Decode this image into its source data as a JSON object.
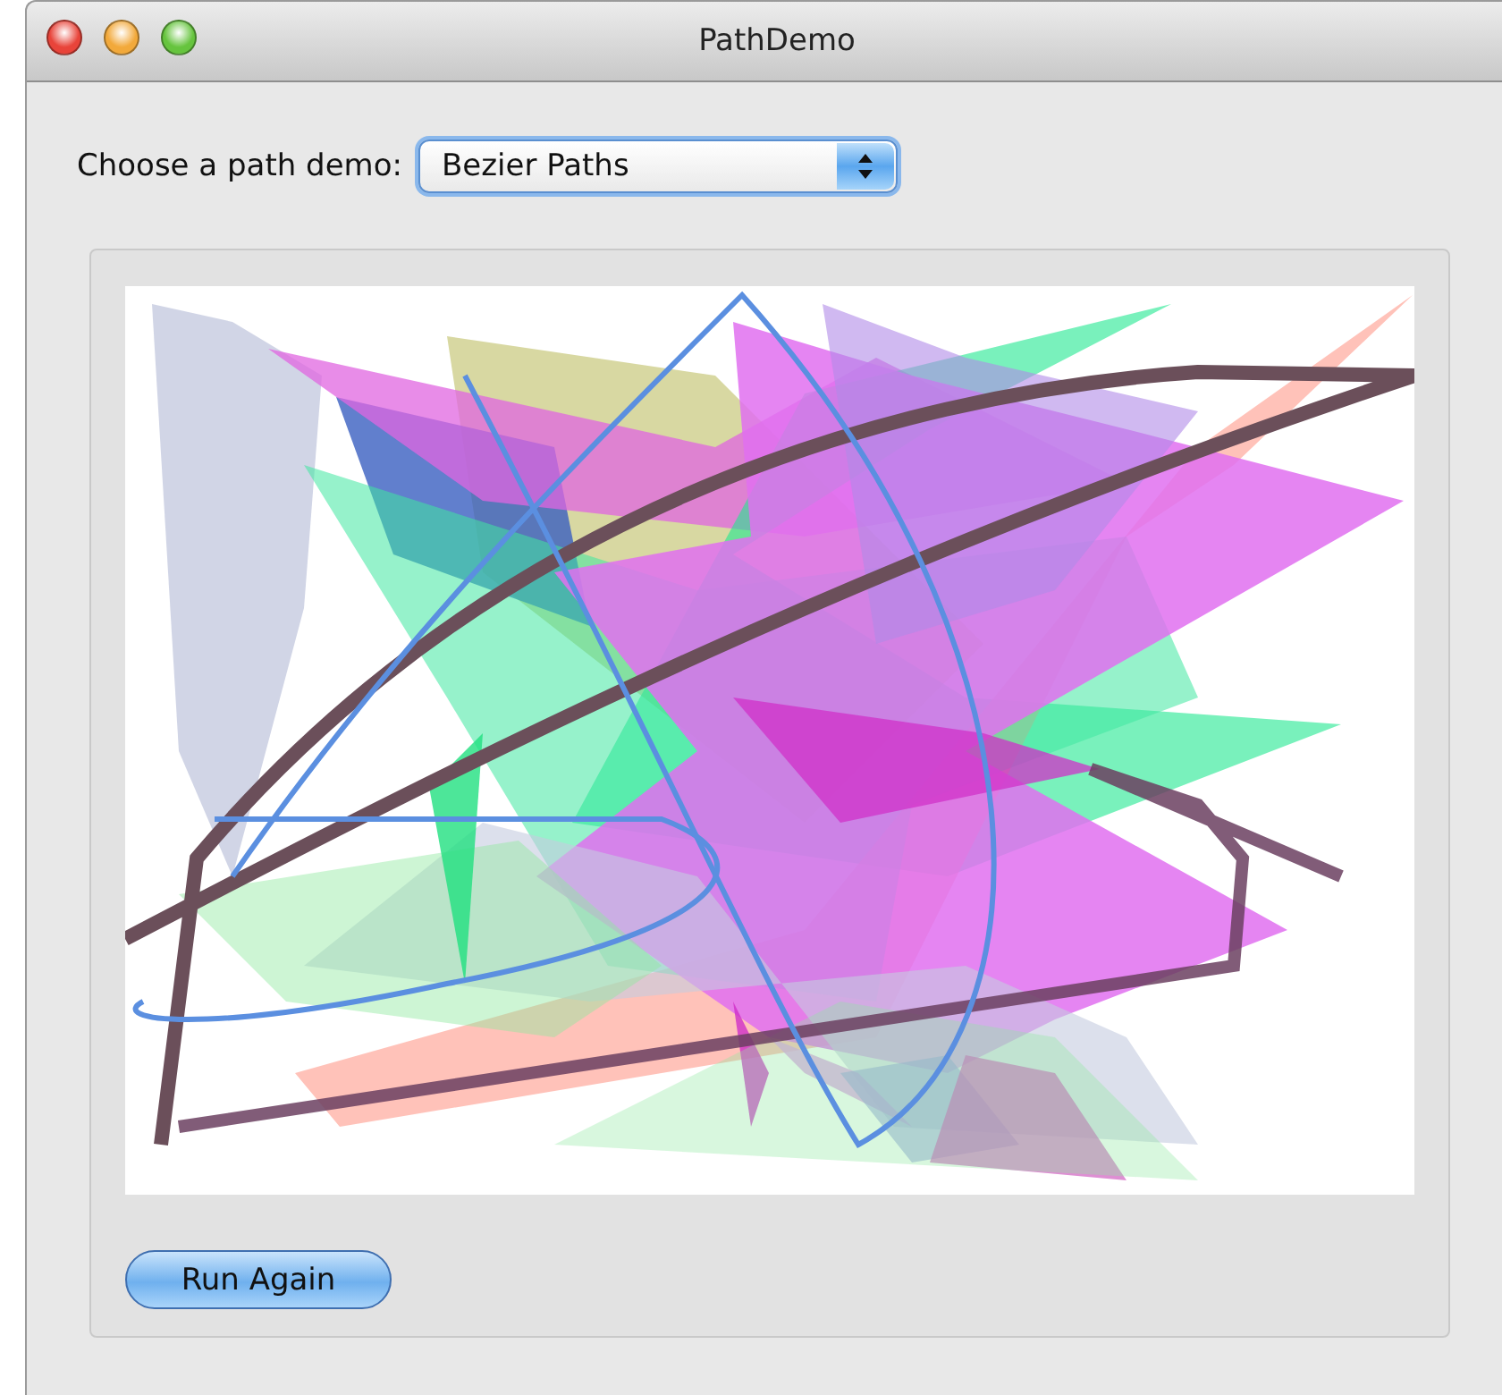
{
  "window": {
    "title": "PathDemo"
  },
  "demo_chooser": {
    "label": "Choose a path demo:",
    "value": "Bezier Paths"
  },
  "buttons": [
    {
      "label": "Run Again"
    }
  ]
}
